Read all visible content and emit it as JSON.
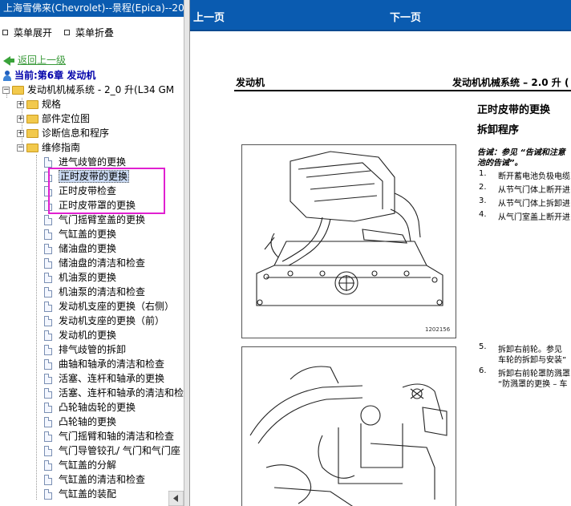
{
  "left_panel": {
    "title": "上海雪佛来(Chevrolet)--景程(Epica)--200",
    "menu_expand": "菜单展开",
    "menu_collapse": "菜单折叠",
    "back_link": "返回上一级",
    "current": "当前:第6章 发动机",
    "tree": {
      "root": "发动机机械系统 - 2_0 升(L34 GM",
      "folders": [
        "规格",
        "部件定位图",
        "诊断信息和程序",
        "维修指南"
      ],
      "items": [
        "进气歧管的更换",
        "正时皮带的更换",
        "正时皮带检查",
        "正时皮带罩的更换",
        "气门摇臂室盖的更换",
        "气缸盖的更换",
        "储油盘的更换",
        "储油盘的清洁和检查",
        "机油泵的更换",
        "机油泵的清洁和检查",
        "发动机支座的更换（右侧）",
        "发动机支座的更换（前）",
        "发动机的更换",
        "排气歧管的拆卸",
        "曲轴和轴承的清洁和检查",
        "活塞、连杆和轴承的更换",
        "活塞、连杆和轴承的清洁和检",
        "凸轮轴齿轮的更换",
        "凸轮轴的更换",
        "气门摇臂和轴的清洁和检查",
        "气门导管铰孔/ 气门和气门座",
        "气缸盖的分解",
        "气缸盖的清洁和检查",
        "气缸盖的装配"
      ],
      "selected_index": 1
    }
  },
  "right_panel": {
    "prev": "上一页",
    "next": "下一页",
    "doc_header_left": "发动机",
    "doc_header_right": "发动机机械系统 – 2.0 升 (",
    "section_title": "正时皮带的更换",
    "subsection_title": "拆卸程序",
    "warning_line1": "告诫：参见 “告诫和注意",
    "warning_line2": "池的告诫”。",
    "steps_top": [
      {
        "num": "1.",
        "text": "断开蓄电池负极电缆"
      },
      {
        "num": "2.",
        "text": "从节气门体上断开进"
      },
      {
        "num": "3.",
        "text": "从节气门体上拆卸进"
      },
      {
        "num": "4.",
        "text": "从气门室盖上断开进"
      }
    ],
    "steps_bottom": [
      {
        "num": "5.",
        "line1": "拆卸右前轮。参见",
        "line2": "车轮的拆卸与安装”"
      },
      {
        "num": "6.",
        "line1": "拆卸右前轮罩防溅罩",
        "line2": "“防溅罩的更换 – 车"
      }
    ],
    "figure1_id": "1202156"
  },
  "colors": {
    "titlebar": "#0a5bb0",
    "highlight_box": "#e020d0",
    "back_link": "#3a9a3a",
    "current_text": "#0000aa"
  }
}
